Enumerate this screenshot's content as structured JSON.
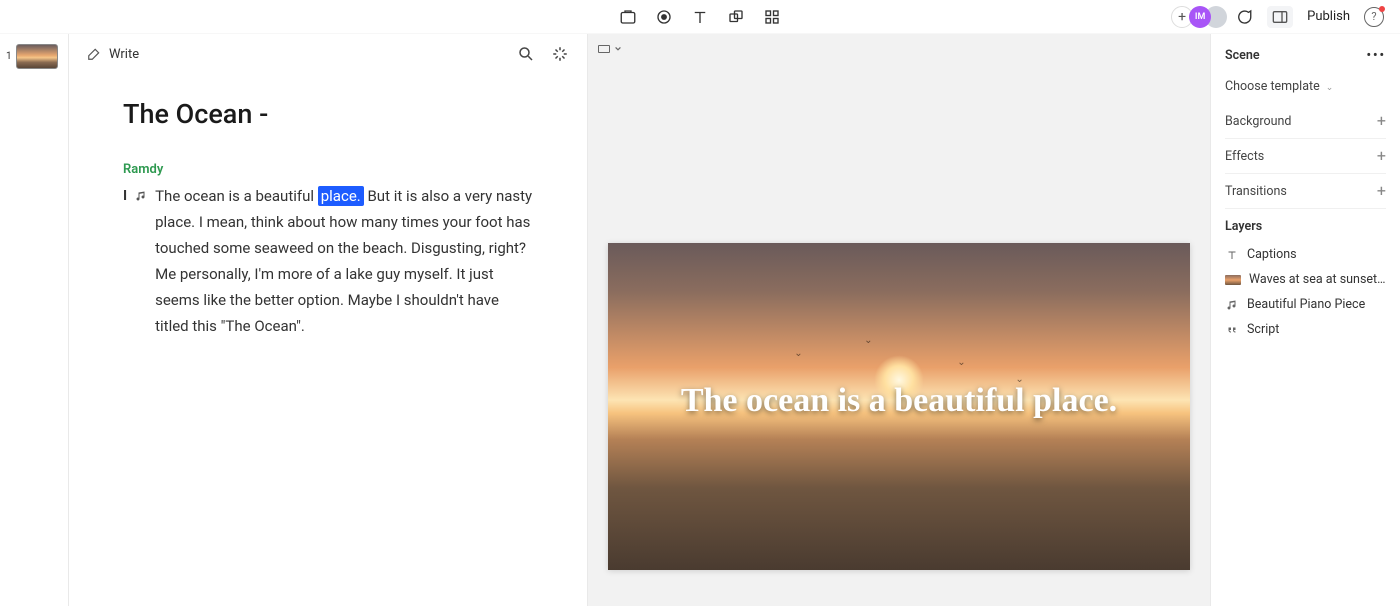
{
  "topbar": {
    "publish_label": "Publish",
    "avatar1_initials": "IM"
  },
  "scenes": {
    "items": [
      {
        "num": "1"
      }
    ]
  },
  "editor": {
    "write_label": "Write",
    "title": "The Ocean -",
    "speaker": "Ramdy",
    "line_marker": "I",
    "script_pre": "The ocean is a beautiful ",
    "script_highlight": "place.",
    "script_post": " But it is also a very nasty place. I mean, think about how many times your foot has touched some seaweed on the beach. Disgusting, right? Me personally, I'm more of a lake guy myself. It just seems like the better option. Maybe I shouldn't have titled this \"The Ocean\"."
  },
  "canvas": {
    "caption": "The ocean is a beautiful place."
  },
  "right": {
    "title": "Scene",
    "choose_template": "Choose template",
    "background": "Background",
    "effects": "Effects",
    "transitions": "Transitions",
    "layers_title": "Layers",
    "layers": {
      "captions": "Captions",
      "media": "Waves at sea at sunset. Flocks...",
      "music": "Beautiful Piano Piece",
      "script": "Script"
    }
  }
}
